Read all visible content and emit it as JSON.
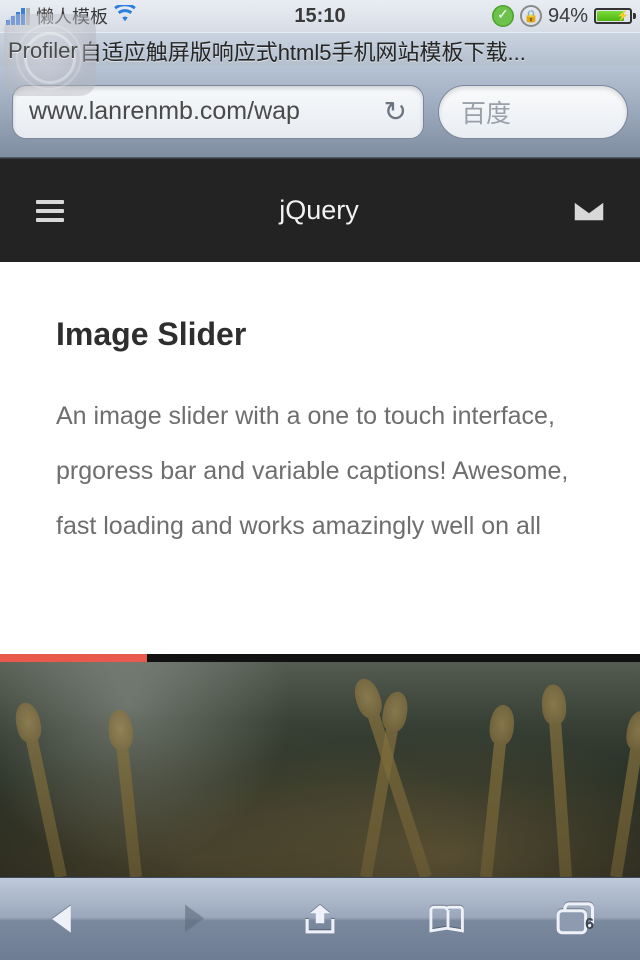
{
  "status": {
    "carrier": "懒人模板",
    "time": "15:10",
    "battery_pct": "94%"
  },
  "browser": {
    "overlay_label": "Profiler",
    "page_title": "自适应触屏版响应式html5手机网站模板下载...",
    "url": "www.lanrenmb.com/wap",
    "search_placeholder": "百度",
    "tab_count": "6"
  },
  "header": {
    "title": "jQuery"
  },
  "content": {
    "heading": "Image Slider",
    "paragraph": "An image slider with a one to touch interface, prgoress bar and variable captions! Awesome, fast loading and works amazingly well on all"
  }
}
